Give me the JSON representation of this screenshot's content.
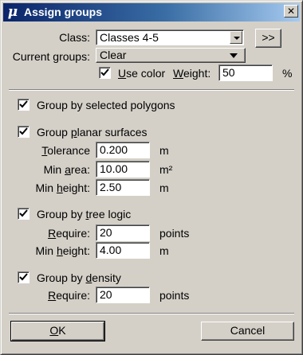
{
  "window": {
    "title": "Assign groups",
    "app_icon": "μ",
    "close_glyph": "✕"
  },
  "class_row": {
    "label_pre": "",
    "label_ul": "",
    "label": "Class:",
    "value": "Classes 4-5",
    "more_button": ">>"
  },
  "groups_row": {
    "label": "Current groups:",
    "value": "Clear"
  },
  "color_row": {
    "use_color_label_ul": "U",
    "use_color_label_rest": "se color",
    "use_color_checked": true,
    "weight_label_ul": "W",
    "weight_label_rest": "eight:",
    "weight_value": "50",
    "weight_unit": "%"
  },
  "polygons": {
    "label": "Group by selected polygons",
    "checked": true
  },
  "planar": {
    "label_pre": "Group ",
    "label_ul": "p",
    "label_post": "lanar surfaces",
    "checked": true,
    "tolerance": {
      "label_ul": "T",
      "label_rest": "olerance",
      "value": "0.200",
      "unit": "m"
    },
    "min_area": {
      "label_pre": "Min ",
      "label_ul": "a",
      "label_post": "rea:",
      "value": "10.00",
      "unit": "m²"
    },
    "min_height": {
      "label_pre": "Min ",
      "label_ul": "h",
      "label_post": "eight:",
      "value": "2.50",
      "unit": "m"
    }
  },
  "tree": {
    "label_pre": "Group by ",
    "label_ul": "t",
    "label_post": "ree logic",
    "checked": true,
    "require": {
      "label_ul": "R",
      "label_rest": "equire:",
      "value": "20",
      "unit": "points"
    },
    "min_height": {
      "label_pre": "Min ",
      "label_ul": "h",
      "label_post": "eight:",
      "value": "4.00",
      "unit": "m"
    }
  },
  "density": {
    "label_pre": "Group by ",
    "label_ul": "d",
    "label_post": "ensity",
    "checked": true,
    "require": {
      "label_ul": "R",
      "label_rest": "equire:",
      "value": "20",
      "unit": "points"
    }
  },
  "buttons": {
    "ok_ul": "O",
    "ok_rest": "K",
    "cancel": "Cancel"
  }
}
